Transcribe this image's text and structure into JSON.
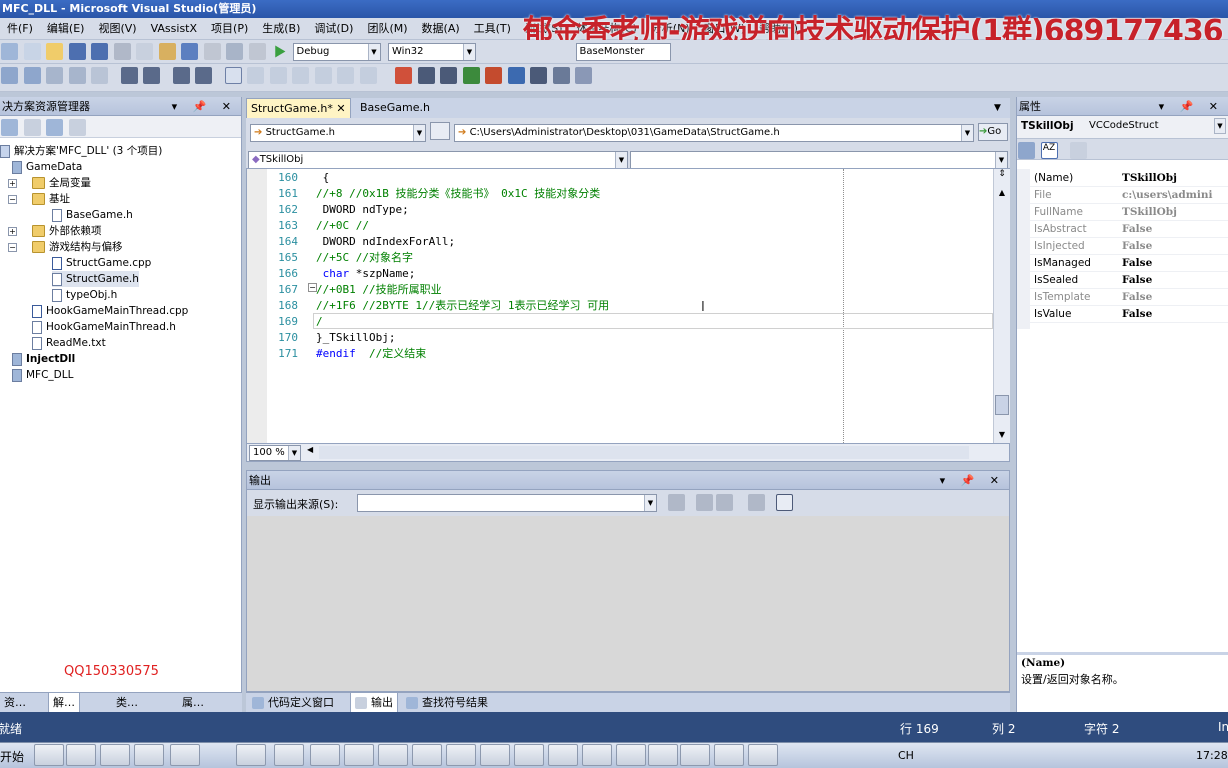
{
  "window": {
    "title": "MFC_DLL - Microsoft Visual Studio(管理员)"
  },
  "watermark": "郁金香老师-游戏逆向技术驱动保护(1群)689177436",
  "menu": [
    "件(F)",
    "编辑(E)",
    "视图(V)",
    "VAssistX",
    "项目(P)",
    "生成(B)",
    "调试(D)",
    "团队(M)",
    "数据(A)",
    "工具(T)",
    "测试(S)",
    "体系结构(C)",
    "分析(N)",
    "窗口(W)",
    "帮助(H)"
  ],
  "toolbar": {
    "config": "Debug",
    "platform": "Win32",
    "find": "BaseMonster"
  },
  "solution_explorer": {
    "title": "决方案资源管理器",
    "nodes": [
      "解决方案'MFC_DLL' (3 个项目)",
      "GameData",
      "全局变量",
      "基址",
      "BaseGame.h",
      "外部依赖项",
      "游戏结构与偏移",
      "StructGame.cpp",
      "StructGame.h",
      "typeObj.h",
      "HookGameMainThread.cpp",
      "HookGameMainThread.h",
      "ReadMe.txt",
      "InjectDll",
      "MFC_DLL"
    ],
    "qq": "QQ150330575"
  },
  "editor": {
    "tabs": [
      "StructGame.h*",
      "BaseGame.h"
    ],
    "file_combo": "StructGame.h",
    "path": "C:\\Users\\Administrator\\Desktop\\031\\GameData\\StructGame.h",
    "go": "Go",
    "scope": "TSkillObj",
    "zoom": "100 %",
    "lines": [
      {
        "n": "160",
        "parts": [
          {
            "t": " {",
            "c": ""
          }
        ]
      },
      {
        "n": "161",
        "parts": [
          {
            "t": "//+8 //0x1B 技能分类《技能书》 0x1C 技能对象分类",
            "c": "cm"
          }
        ]
      },
      {
        "n": "162",
        "parts": [
          {
            "t": " DWORD ndType;",
            "c": ""
          }
        ]
      },
      {
        "n": "163",
        "parts": [
          {
            "t": "//+0C //",
            "c": "cm"
          }
        ]
      },
      {
        "n": "164",
        "parts": [
          {
            "t": " DWORD ndIndexForAll;",
            "c": ""
          }
        ]
      },
      {
        "n": "165",
        "parts": [
          {
            "t": "//+5C //对象名字",
            "c": "cm"
          }
        ]
      },
      {
        "n": "166",
        "parts": [
          {
            "t": " ",
            "c": ""
          },
          {
            "t": "char",
            "c": "kw"
          },
          {
            "t": " *szpName;",
            "c": ""
          }
        ]
      },
      {
        "n": "167",
        "parts": [
          {
            "t": "//+0B1 //技能所属职业",
            "c": "cm"
          }
        ]
      },
      {
        "n": "168",
        "parts": [
          {
            "t": "//+1F6 //2BYTE 1//表示已经学习 1表示已经学习 可用",
            "c": "cm"
          }
        ]
      },
      {
        "n": "169",
        "parts": [
          {
            "t": "/",
            "c": "cm"
          }
        ]
      },
      {
        "n": "170",
        "parts": [
          {
            "t": "}_TSkillObj;",
            "c": ""
          }
        ]
      },
      {
        "n": "171",
        "parts": [
          {
            "t": "#endif",
            "c": "kw"
          },
          {
            "t": "  ",
            "c": ""
          },
          {
            "t": "//定义结束",
            "c": "cm"
          }
        ]
      }
    ]
  },
  "output": {
    "title": "输出",
    "label": "显示输出来源(S):"
  },
  "properties": {
    "title": "属性",
    "object": "TSkillObj",
    "type": "VCCodeStruct",
    "rows": [
      {
        "k": "(Name)",
        "v": "TSkillObj",
        "dim": false
      },
      {
        "k": "File",
        "v": "c:\\users\\admini",
        "dim": true
      },
      {
        "k": "FullName",
        "v": "TSkillObj",
        "dim": true
      },
      {
        "k": "IsAbstract",
        "v": "False",
        "dim": true
      },
      {
        "k": "IsInjected",
        "v": "False",
        "dim": true
      },
      {
        "k": "IsManaged",
        "v": "False",
        "dim": false
      },
      {
        "k": "IsSealed",
        "v": "False",
        "dim": false
      },
      {
        "k": "IsTemplate",
        "v": "False",
        "dim": true
      },
      {
        "k": "IsValue",
        "v": "False",
        "dim": false
      }
    ],
    "desc_title": "(Name)",
    "desc": "设置/返回对象名称。"
  },
  "bottom_tabs_left": [
    "资…",
    "解…",
    "类…",
    "属…"
  ],
  "bottom_tabs_mid": [
    "代码定义窗口",
    "输出",
    "查找符号结果"
  ],
  "status": {
    "left": "就绪",
    "line": "行 169",
    "col": "列 2",
    "ch": "字符 2",
    "ins": "Ins"
  },
  "taskbar": {
    "start": "开始",
    "lang": "CH",
    "clock": "17:28"
  }
}
